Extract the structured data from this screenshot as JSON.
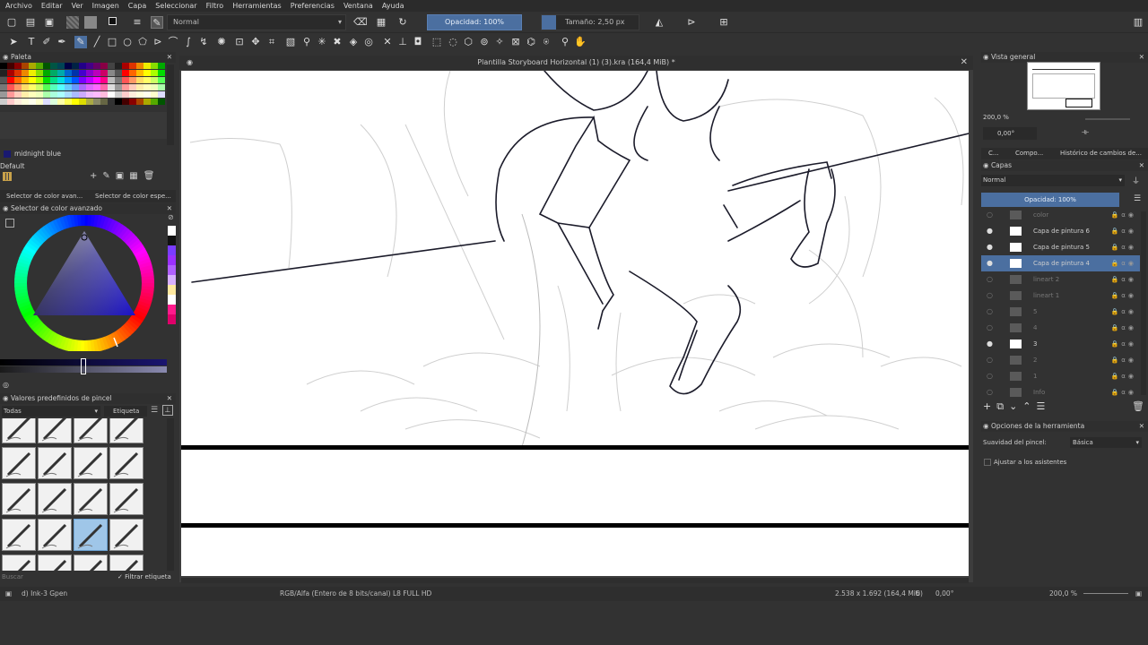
{
  "menu": [
    "Archivo",
    "Editar",
    "Ver",
    "Imagen",
    "Capa",
    "Seleccionar",
    "Filtro",
    "Herramientas",
    "Preferencias",
    "Ventana",
    "Ayuda"
  ],
  "toolbar": {
    "blend_mode": "Normal",
    "opacity": "Opacidad: 100%",
    "size": "Tamaño: 2,50 px"
  },
  "palette": {
    "title": "Paleta",
    "color_name": "midnight blue",
    "set_name": "Default"
  },
  "color_selector": {
    "tab1": "Selector de color avan...",
    "tab2": "Selector de color espe...",
    "title": "Selector de color avanzado"
  },
  "brush_presets": {
    "title": "Valores predefinidos de pincel",
    "filter": "Todas",
    "tag": "Etiqueta",
    "search_placeholder": "Buscar",
    "filter_tag": "Filtrar etiqueta"
  },
  "document": {
    "title": "Plantilla Storyboard Horizontal (1) (3).kra (164,4 MiB) *"
  },
  "overview": {
    "title": "Vista general",
    "zoom": "200,0 %",
    "rotation": "0,00°"
  },
  "layers_panel": {
    "tabs": [
      "C...",
      "Compo...",
      "Histórico de cambios de..."
    ],
    "title": "Capas",
    "blend_mode": "Normal",
    "opacity": "Opacidad: 100%",
    "layers": [
      {
        "name": "color",
        "visible": false,
        "white": false
      },
      {
        "name": "Capa de pintura 6",
        "visible": true,
        "white": true
      },
      {
        "name": "Capa de pintura 5",
        "visible": true,
        "white": true
      },
      {
        "name": "Capa de pintura 4",
        "visible": true,
        "white": true,
        "selected": true
      },
      {
        "name": "lineart 2",
        "visible": false,
        "white": false
      },
      {
        "name": "lineart 1",
        "visible": false,
        "white": false
      },
      {
        "name": "5",
        "visible": false,
        "white": false
      },
      {
        "name": "4",
        "visible": false,
        "white": false
      },
      {
        "name": "3",
        "visible": true,
        "white": true
      },
      {
        "name": "2",
        "visible": false,
        "white": false
      },
      {
        "name": "1",
        "visible": false,
        "white": false
      },
      {
        "name": "Info",
        "visible": false,
        "white": false
      }
    ]
  },
  "tool_options": {
    "title": "Opciones de la herramienta",
    "smoothing_label": "Suavidad del pincel:",
    "smoothing_value": "Básica",
    "assistants_label": "Ajustar a los asistentes"
  },
  "status": {
    "brush": "d) Ink-3 Gpen",
    "color_space": "RGB/Alfa (Entero de 8 bits/canal)  L8 FULL HD",
    "dimensions": "2.538 x 1.692 (164,4 MiB)",
    "rotation": "0,00°",
    "zoom": "200,0 %"
  },
  "colors": {
    "accent": "#4b6fa0",
    "panel": "#323232"
  }
}
